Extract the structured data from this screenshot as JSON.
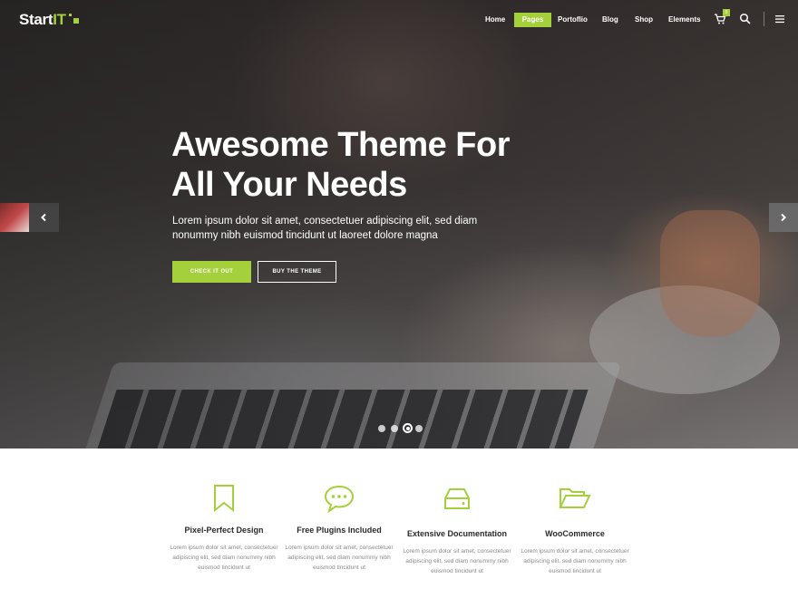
{
  "brand": {
    "name": "StartIT",
    "accent_color": "#a4d03b"
  },
  "nav": {
    "items": [
      {
        "label": "Home",
        "active": false
      },
      {
        "label": "Pages",
        "active": true
      },
      {
        "label": "Portoflio",
        "active": false
      },
      {
        "label": "Blog",
        "active": false
      },
      {
        "label": "Shop",
        "active": false
      },
      {
        "label": "Elements",
        "active": false
      }
    ],
    "cart_count": "0",
    "icons": [
      "cart-icon",
      "search-icon",
      "hamburger-menu-icon"
    ]
  },
  "hero": {
    "headline_line1": "Awesome Theme For",
    "headline_line2": "All Your Needs",
    "subtext": "Lorem ipsum dolor sit amet, consectetuer adipiscing elit, sed diam nonummy nibh euismod tincidunt ut laoreet dolore magna",
    "primary_button": "CHECK IT OUT",
    "secondary_button": "BUY THE THEME",
    "slide_count": 4,
    "active_slide": 3
  },
  "features": [
    {
      "icon": "bookmark-icon",
      "title": "Pixel-Perfect Design",
      "text": "Lorem ipsum dolor sit amet, consectetuer adipiscing elit, sed diam nonummy nibh euismod tincidunt ut"
    },
    {
      "icon": "chat-bubble-icon",
      "title": "Free Plugins Included",
      "text": "Lorem ipsum dolor sit amet, consectetuer adipiscing elit, sed diam nonummy nibh euismod tincidunt ut"
    },
    {
      "icon": "hard-drive-icon",
      "title": "Extensive Documentation",
      "text": "Lorem ipsum dolor sit amet, consectetuer adipiscing elit, sed diam nonummy nibh euismod tincidunt ut"
    },
    {
      "icon": "folder-open-icon",
      "title": "WooCommerce",
      "text": "Lorem ipsum dolor sit amet, consectetuer adipiscing elit, sed diam nonummy nibh euismod tincidunt ut"
    }
  ]
}
